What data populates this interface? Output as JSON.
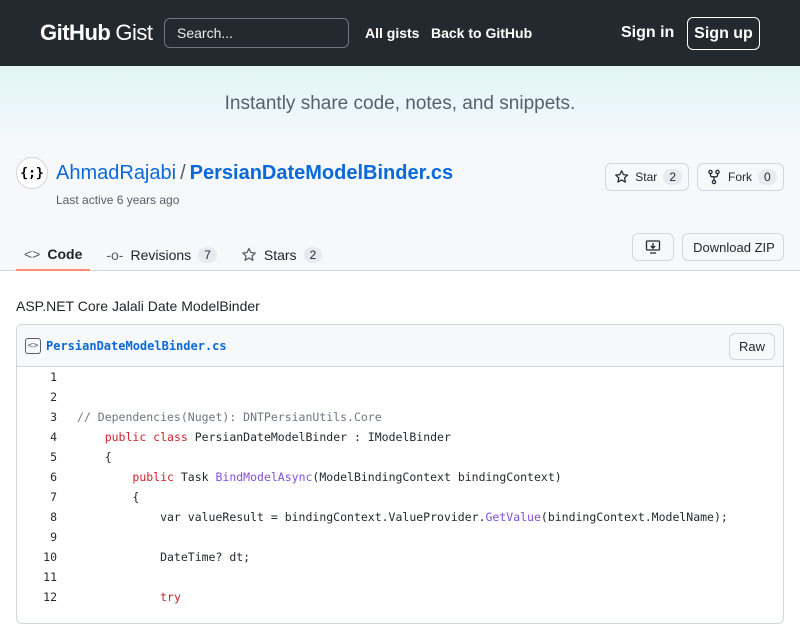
{
  "header": {
    "logo_bold": "GitHub",
    "logo_light": "Gist",
    "search_placeholder": "Search...",
    "all_gists": "All gists",
    "back_to_github": "Back to GitHub",
    "sign_in": "Sign in",
    "sign_up": "Sign up"
  },
  "hero": {
    "tagline": "Instantly share code, notes, and snippets."
  },
  "gist": {
    "avatar_text": "{;}",
    "owner": "AhmadRajabi",
    "separator": "/",
    "file_title": "PersianDateModelBinder.cs",
    "last_active": "Last active 6 years ago",
    "star_label": "Star",
    "star_count": "2",
    "fork_label": "Fork",
    "fork_count": "0",
    "tabs": [
      {
        "label": "Code",
        "count": ""
      },
      {
        "label": "Revisions",
        "count": "7"
      },
      {
        "label": "Stars",
        "count": "2"
      }
    ],
    "download_zip": "Download ZIP",
    "description": "ASP.NET Core Jalali Date ModelBinder",
    "file_name": "PersianDateModelBinder.cs",
    "raw_label": "Raw",
    "code_lines": [
      {
        "n": "1",
        "segments": []
      },
      {
        "n": "2",
        "segments": []
      },
      {
        "n": "3",
        "segments": [
          {
            "t": "// Dependencies(Nuget): DNTPersianUtils.Core",
            "c": "cm"
          }
        ]
      },
      {
        "n": "4",
        "segments": [
          {
            "t": "    ",
            "c": ""
          },
          {
            "t": "public class",
            "c": "kw"
          },
          {
            "t": " PersianDateModelBinder : IModelBinder",
            "c": ""
          }
        ]
      },
      {
        "n": "5",
        "segments": [
          {
            "t": "    {",
            "c": ""
          }
        ]
      },
      {
        "n": "6",
        "segments": [
          {
            "t": "        ",
            "c": ""
          },
          {
            "t": "public",
            "c": "kw"
          },
          {
            "t": " Task ",
            "c": ""
          },
          {
            "t": "BindModelAsync",
            "c": "fn"
          },
          {
            "t": "(ModelBindingContext bindingContext)",
            "c": ""
          }
        ]
      },
      {
        "n": "7",
        "segments": [
          {
            "t": "        {",
            "c": ""
          }
        ]
      },
      {
        "n": "8",
        "segments": [
          {
            "t": "            var valueResult = bindingContext.ValueProvider.",
            "c": ""
          },
          {
            "t": "GetValue",
            "c": "fn"
          },
          {
            "t": "(bindingContext.ModelName);",
            "c": ""
          }
        ]
      },
      {
        "n": "9",
        "segments": []
      },
      {
        "n": "10",
        "segments": [
          {
            "t": "            DateTime? dt;",
            "c": ""
          }
        ]
      },
      {
        "n": "11",
        "segments": []
      },
      {
        "n": "12",
        "segments": [
          {
            "t": "            ",
            "c": ""
          },
          {
            "t": "try",
            "c": "kw"
          }
        ]
      }
    ]
  }
}
